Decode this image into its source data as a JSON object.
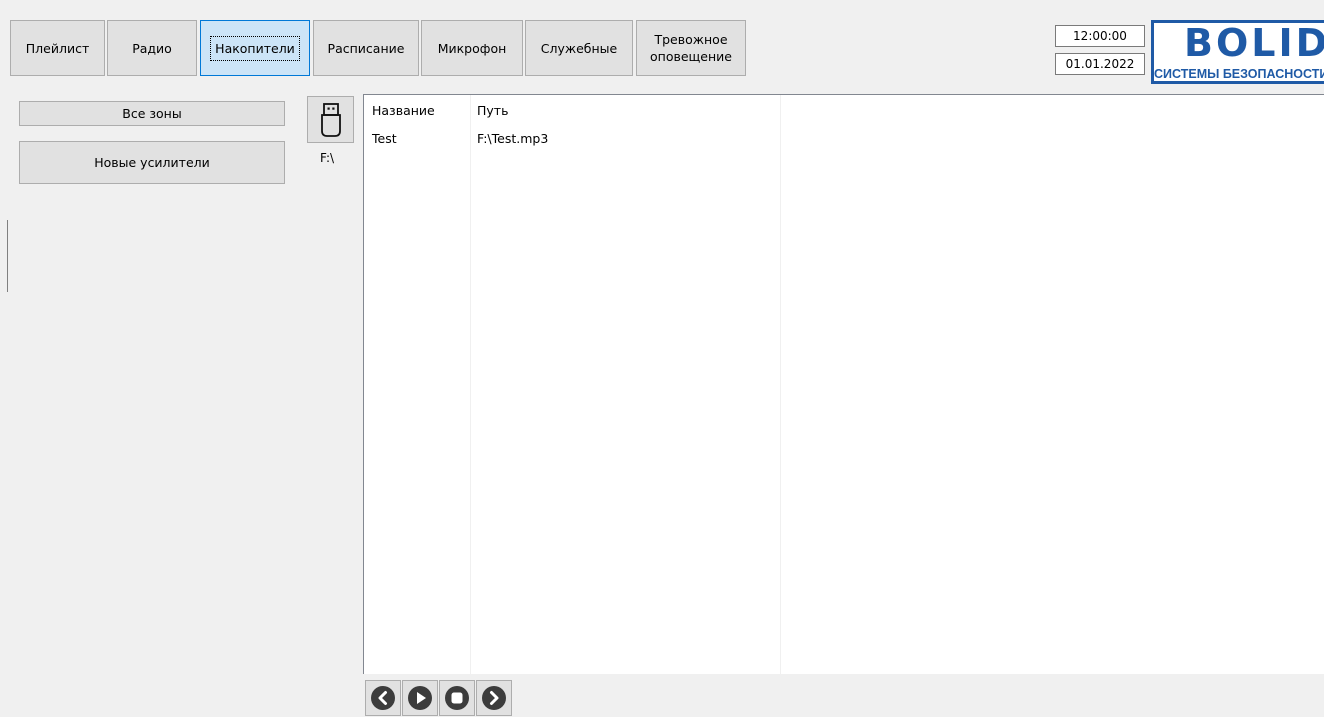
{
  "tabs": [
    {
      "label": "Плейлист",
      "active": false
    },
    {
      "label": "Радио",
      "active": false
    },
    {
      "label": "Накопители",
      "active": true
    },
    {
      "label": "Расписание",
      "active": false
    },
    {
      "label": "Микрофон",
      "active": false
    },
    {
      "label": "Служебные",
      "active": false
    },
    {
      "label": "Тревожное оповещение",
      "active": false
    }
  ],
  "clock": {
    "time": "12:00:00",
    "date": "01.01.2022"
  },
  "logo": {
    "word": "BOLID",
    "subtitle": "СИСТЕМЫ БЕЗОПАСНОСТИ"
  },
  "zones": {
    "all_zones": "Все зоны",
    "new_amplifiers": "Новые усилители"
  },
  "drive": {
    "icon": "usb-flash-drive-icon",
    "label": "F:\\"
  },
  "file_list": {
    "columns": [
      "Название",
      "Путь"
    ],
    "rows": [
      {
        "name": "Test",
        "path": "F:\\Test.mp3"
      }
    ]
  },
  "player_controls": [
    {
      "name": "previous-icon"
    },
    {
      "name": "play-icon"
    },
    {
      "name": "stop-icon"
    },
    {
      "name": "next-icon"
    }
  ],
  "colors": {
    "accent": "#0078d7",
    "logo_blue": "#1f5aa6",
    "button_face": "#e1e1e1",
    "control_dark": "#3c3c3c"
  }
}
